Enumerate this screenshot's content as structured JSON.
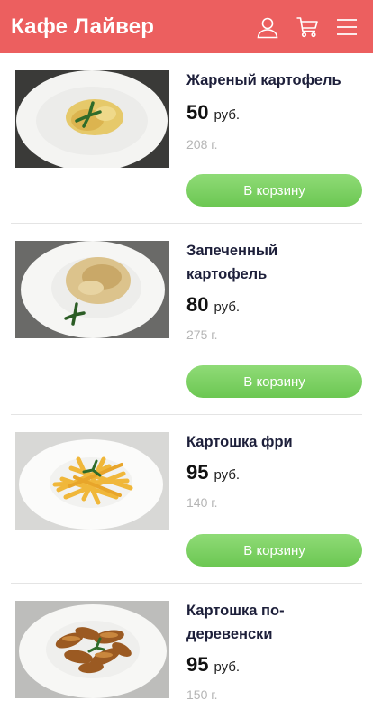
{
  "header": {
    "title": "Кафе Лайвер",
    "color": "#ec5f5f",
    "icons": [
      "user-icon",
      "cart-icon",
      "menu-icon"
    ]
  },
  "items": [
    {
      "name_lines": [
        "Жареный картофель"
      ],
      "price": "50",
      "currency": "руб.",
      "weight": "208 г.",
      "button": "В корзину",
      "image": "fried-potatoes"
    },
    {
      "name_lines": [
        "Запеченный",
        "картофель"
      ],
      "price": "80",
      "currency": "руб.",
      "weight": "275 г.",
      "button": "В корзину",
      "image": "baked-potatoes"
    },
    {
      "name_lines": [
        "Картошка фри"
      ],
      "price": "95",
      "currency": "руб.",
      "weight": "140 г.",
      "button": "В корзину",
      "image": "french-fries"
    },
    {
      "name_lines": [
        "Картошка по-",
        "деревенски"
      ],
      "price": "95",
      "currency": "руб.",
      "weight": "150 г.",
      "button": "В корзину",
      "image": "country-potatoes"
    }
  ]
}
